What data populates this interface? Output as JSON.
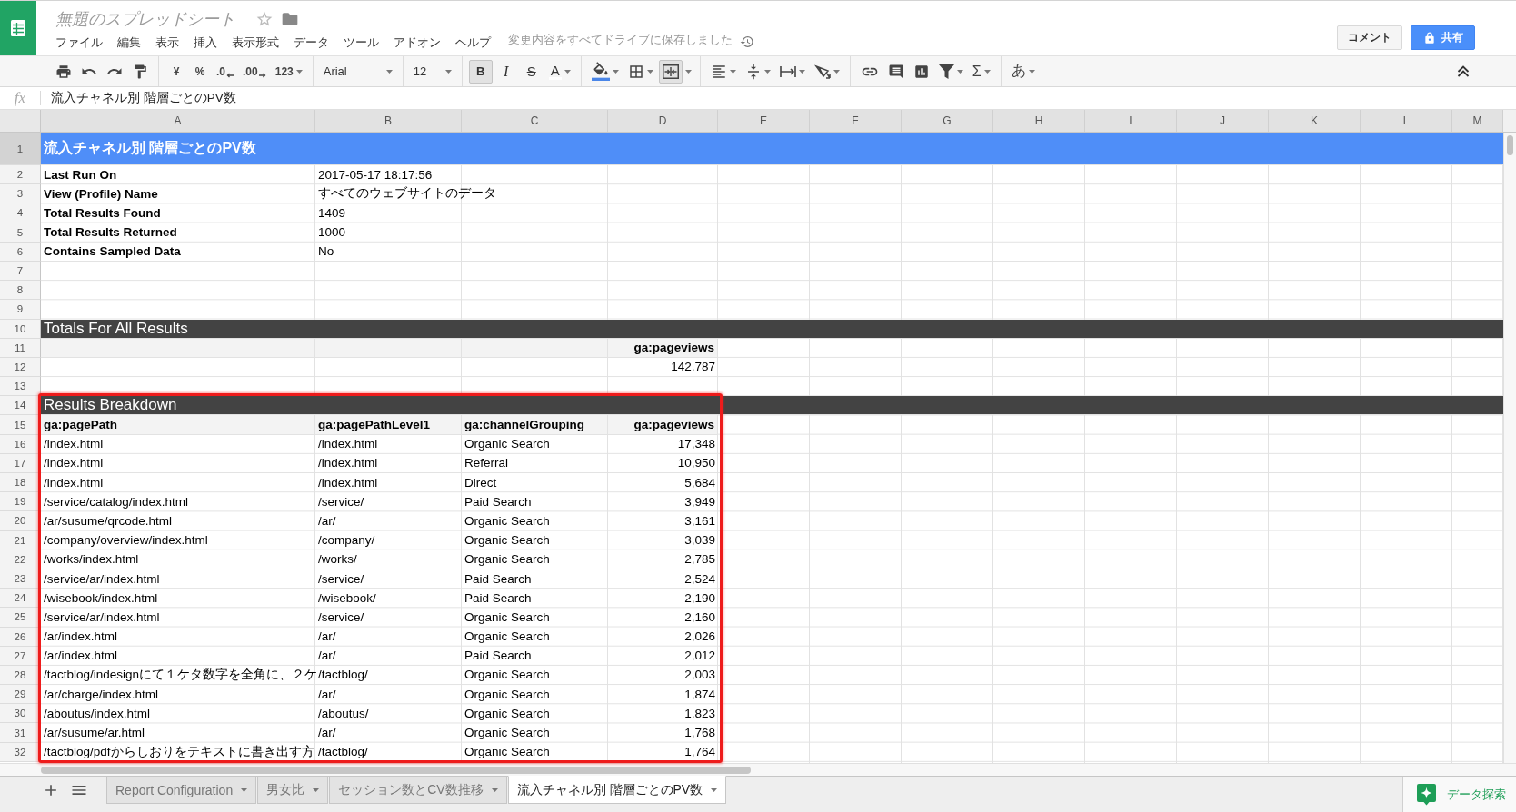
{
  "document": {
    "title": "無題のスプレッドシート",
    "save_status": "変更内容をすべてドライブに保存しました"
  },
  "menu": [
    "ファイル",
    "編集",
    "表示",
    "挿入",
    "表示形式",
    "データ",
    "ツール",
    "アドオン",
    "ヘルプ"
  ],
  "buttons": {
    "comment": "コメント",
    "share": "共有"
  },
  "toolbar": {
    "currency": "¥",
    "percent": "%",
    "decrease_decimals": ".0",
    "increase_decimals": ".00",
    "number_format": "123",
    "font": "Arial",
    "font_size": "12",
    "bold": {
      "label": "B",
      "selected": true
    },
    "italic": {
      "label": "I",
      "selected": false
    },
    "strikethrough": {
      "label": "S",
      "selected": false
    },
    "text_color": "A",
    "merge": {
      "selected": true
    },
    "functions": "Σ",
    "input_tools": "あ"
  },
  "formula_bar": {
    "label": "fx",
    "value": "流入チャネル別 階層ごとのPV数"
  },
  "sheet": {
    "columns": [
      {
        "label": "A",
        "selected": true
      },
      {
        "label": "B",
        "selected": true
      },
      {
        "label": "C",
        "selected": true
      },
      {
        "label": "D",
        "selected": true
      },
      {
        "label": "E",
        "selected": true
      },
      {
        "label": "F",
        "selected": true
      },
      {
        "label": "G",
        "selected": true
      },
      {
        "label": "H",
        "selected": true
      },
      {
        "label": "I",
        "selected": true
      },
      {
        "label": "J",
        "selected": true
      },
      {
        "label": "K",
        "selected": true
      },
      {
        "label": "L",
        "selected": true
      },
      {
        "label": "M",
        "selected": true
      }
    ],
    "rows": [
      {
        "number": "1",
        "selected": true,
        "kind": "title",
        "cells": [
          "流入チャネル別 階層ごとのPV数"
        ]
      },
      {
        "number": "2",
        "selected": false,
        "kind": "label",
        "cells": [
          "Last Run On",
          "2017-05-17 18:17:56"
        ]
      },
      {
        "number": "3",
        "selected": false,
        "kind": "label",
        "cells": [
          "View (Profile) Name",
          "すべてのウェブサイトのデータ"
        ]
      },
      {
        "number": "4",
        "selected": false,
        "kind": "label",
        "cells": [
          "Total Results Found",
          "1409"
        ]
      },
      {
        "number": "5",
        "selected": false,
        "kind": "label",
        "cells": [
          "Total Results Returned",
          "1000"
        ]
      },
      {
        "number": "6",
        "selected": false,
        "kind": "label",
        "cells": [
          "Contains Sampled Data",
          "No"
        ]
      },
      {
        "number": "7",
        "selected": false,
        "kind": "blank"
      },
      {
        "number": "8",
        "selected": false,
        "kind": "blank"
      },
      {
        "number": "9",
        "selected": false,
        "kind": "blank"
      },
      {
        "number": "10",
        "selected": false,
        "kind": "section",
        "cells": [
          "Totals For All Results"
        ]
      },
      {
        "number": "11",
        "selected": false,
        "kind": "header",
        "cells": [
          null,
          null,
          null,
          "ga:pageviews"
        ]
      },
      {
        "number": "12",
        "selected": false,
        "kind": "data",
        "cells": [
          null,
          null,
          null,
          "142,787"
        ]
      },
      {
        "number": "13",
        "selected": false,
        "kind": "blank"
      }
    ],
    "framed_rows": [
      {
        "number": "14",
        "selected": false,
        "kind": "section",
        "cells": [
          "Results Breakdown"
        ]
      },
      {
        "number": "15",
        "selected": false,
        "kind": "header",
        "cells": [
          "ga:pagePath",
          "ga:pagePathLevel1",
          "ga:channelGrouping",
          "ga:pageviews"
        ]
      },
      {
        "number": "16",
        "selected": false,
        "kind": "data",
        "cells": [
          "/index.html",
          "/index.html",
          "Organic Search",
          "17,348"
        ]
      },
      {
        "number": "17",
        "selected": false,
        "kind": "data",
        "cells": [
          "/index.html",
          "/index.html",
          "Referral",
          "10,950"
        ]
      },
      {
        "number": "18",
        "selected": false,
        "kind": "data",
        "cells": [
          "/index.html",
          "/index.html",
          "Direct",
          "5,684"
        ]
      },
      {
        "number": "19",
        "selected": false,
        "kind": "data",
        "cells": [
          "/service/catalog/index.html",
          "/service/",
          "Paid Search",
          "3,949"
        ]
      },
      {
        "number": "20",
        "selected": false,
        "kind": "data",
        "cells": [
          "/ar/susume/qrcode.html",
          "/ar/",
          "Organic Search",
          "3,161"
        ]
      },
      {
        "number": "21",
        "selected": false,
        "kind": "data",
        "cells": [
          "/company/overview/index.html",
          "/company/",
          "Organic Search",
          "3,039"
        ]
      },
      {
        "number": "22",
        "selected": false,
        "kind": "data",
        "cells": [
          "/works/index.html",
          "/works/",
          "Organic Search",
          "2,785"
        ]
      },
      {
        "number": "23",
        "selected": false,
        "kind": "data",
        "cells": [
          "/service/ar/index.html",
          "/service/",
          "Paid Search",
          "2,524"
        ]
      },
      {
        "number": "24",
        "selected": false,
        "kind": "data",
        "cells": [
          "/wisebook/index.html",
          "/wisebook/",
          "Paid Search",
          "2,190"
        ]
      },
      {
        "number": "25",
        "selected": false,
        "kind": "data",
        "cells": [
          "/service/ar/index.html",
          "/service/",
          "Organic Search",
          "2,160"
        ]
      },
      {
        "number": "26",
        "selected": false,
        "kind": "data",
        "cells": [
          "/ar/index.html",
          "/ar/",
          "Organic Search",
          "2,026"
        ]
      },
      {
        "number": "27",
        "selected": false,
        "kind": "data",
        "cells": [
          "/ar/index.html",
          "/ar/",
          "Paid Search",
          "2,012"
        ]
      },
      {
        "number": "28",
        "selected": false,
        "kind": "data",
        "cells": [
          "/tactblog/indesignにて１ケタ数字を全角に、２ケ",
          "/tactblog/",
          "Organic Search",
          "2,003"
        ]
      },
      {
        "number": "29",
        "selected": false,
        "kind": "data",
        "cells": [
          "/ar/charge/index.html",
          "/ar/",
          "Organic Search",
          "1,874"
        ]
      },
      {
        "number": "30",
        "selected": false,
        "kind": "data",
        "cells": [
          "/aboutus/index.html",
          "/aboutus/",
          "Organic Search",
          "1,823"
        ]
      },
      {
        "number": "31",
        "selected": false,
        "kind": "data",
        "cells": [
          "/ar/susume/ar.html",
          "/ar/",
          "Organic Search",
          "1,768"
        ]
      },
      {
        "number": "32",
        "selected": false,
        "kind": "data",
        "cells": [
          "/tactblog/pdfからしおりをテキストに書き出す方",
          "/tactblog/",
          "Organic Search",
          "1,764"
        ]
      }
    ]
  },
  "sheet_tabs": [
    {
      "label": "Report Configuration",
      "selected": false
    },
    {
      "label": "男女比",
      "selected": false
    },
    {
      "label": "セッション数とCV数推移",
      "selected": false
    },
    {
      "label": "流入チャネル別 階層ごとのPV数",
      "selected": true
    }
  ],
  "explore_button": "データ探索"
}
